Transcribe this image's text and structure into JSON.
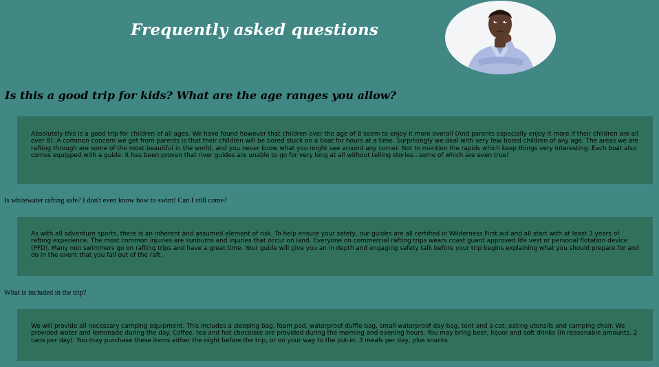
{
  "header": {
    "title": "Frequently asked questions",
    "avatar_icon": "thinking-man-icon"
  },
  "faq": [
    {
      "question": "Is this a good trip for kids? What are the age ranges you allow?",
      "answer": "Absolutely this is a good trip for children of all ages. We have found however that children over the age of 8 seem to enjoy it more overall (And parents especially enjoy it more if their children are all over 8). A common concern we get from parents is that their children will be bored stuck on a boat for hours at a time. Surprisingly we deal with very few bored children of any age. The areas we are rafting through are some of the most beautiful in the world, and you never know what you might see around any corner. Not to mention the rapids which keep things very interesting. Each boat also comes equipped with a guide. It has been proven that river guides are unable to go for very long at all without telling stories...some of which are even true!"
    },
    {
      "question": "Is whitewater rafting safe? I don't even know how to swim! Can I still come?",
      "answer": "As with all adventure sports, there is an inherent and assumed element of risk. To help ensure your safety, our guides are all certified in Wilderness First aid and all start with at least 3 years of rafting experience. The most common injuries are sunburns and injuries that occur on land. Everyone on commercial rafting trips wears coast guard approved life vest or personal flotation device (PFD). Many non swimmers go on rafting trips and have a great time. Your guide will give you an in depth and engaging safety talk before your trip begins explaining what you should prepare for and do in the event that you fall out of the raft."
    },
    {
      "question": "What is included in the trip?",
      "answer": "We will provide all necessary camping equipment. This includes a sleeping bag, foam pad, waterproof duffle bag, small waterproof day bag, tent and a cot, eating utensils and camping chair. We provided water and lemonade during the day. Coffee, tea and hot chocolate are provided during the morning and evening hours. You may bring beer, liquor and soft drinks (in reasonable amounts, 2 cans per day). You may purchase these items either the night before the trip, or on your way to the put-in. 3 meals per day, plus snacks"
    }
  ],
  "colors": {
    "page_background": "#418784",
    "answer_background": "#31705c",
    "title_color": "#ffffff"
  }
}
